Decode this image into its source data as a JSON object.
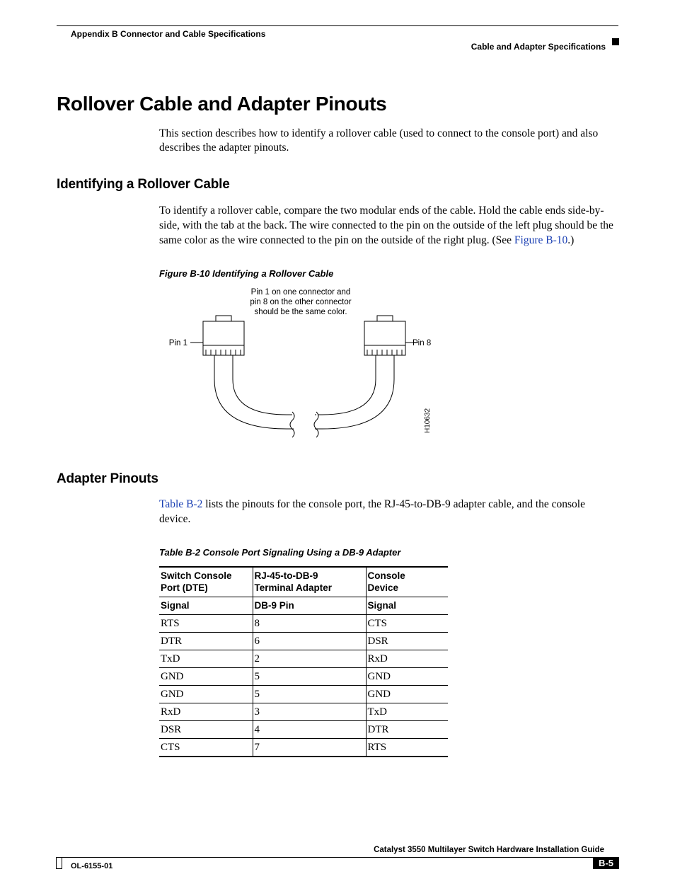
{
  "header": {
    "appendix": "Appendix B     Connector and Cable Specifications",
    "section": "Cable and Adapter Specifications"
  },
  "h1": "Rollover Cable and Adapter Pinouts",
  "intro": "This section describes how to identify a rollover cable (used to connect to the console port) and also describes the adapter pinouts.",
  "sec1": {
    "title": "Identifying a Rollover Cable",
    "para_a": "To identify a rollover cable, compare the two modular ends of the cable. Hold the cable ends side-by-side, with the tab at the back. The wire connected to the pin on the outside of the left plug should be the same color as the wire connected to the pin on the outside of the right plug. (See ",
    "para_link": "Figure B-10",
    "para_b": ".)",
    "fig_caption": "Figure B-10   Identifying a Rollover Cable",
    "fig_text": {
      "top": "Pin 1 on one connector and\npin 8 on the other connector\nshould be the same color.",
      "pin1": "Pin 1",
      "pin8": "Pin 8",
      "code": "H10632"
    }
  },
  "sec2": {
    "title": "Adapter Pinouts",
    "para_link": "Table B-2",
    "para_rest": " lists the pinouts for the console port, the RJ-45-to-DB-9 adapter cable, and the console device.",
    "tbl_caption": "Table B-2      Console Port Signaling Using a DB-9 Adapter",
    "headers1": {
      "c1a": "Switch Console",
      "c1b": "Port (DTE)",
      "c2a": "RJ-45-to-DB-9",
      "c2b": "Terminal Adapter",
      "c3a": "Console",
      "c3b": "Device"
    },
    "headers2": {
      "c1": "Signal",
      "c2": "DB-9 Pin",
      "c3": "Signal"
    },
    "rows": [
      {
        "c1": "RTS",
        "c2": "8",
        "c3": "CTS"
      },
      {
        "c1": "DTR",
        "c2": "6",
        "c3": "DSR"
      },
      {
        "c1": "TxD",
        "c2": "2",
        "c3": "RxD"
      },
      {
        "c1": "GND",
        "c2": "5",
        "c3": "GND"
      },
      {
        "c1": "GND",
        "c2": "5",
        "c3": "GND"
      },
      {
        "c1": "RxD",
        "c2": "3",
        "c3": "TxD"
      },
      {
        "c1": "DSR",
        "c2": "4",
        "c3": "DTR"
      },
      {
        "c1": "CTS",
        "c2": "7",
        "c3": "RTS"
      }
    ]
  },
  "footer": {
    "title": "Catalyst 3550 Multilayer Switch Hardware Installation Guide",
    "left": "OL-6155-01",
    "page": "B-5"
  }
}
